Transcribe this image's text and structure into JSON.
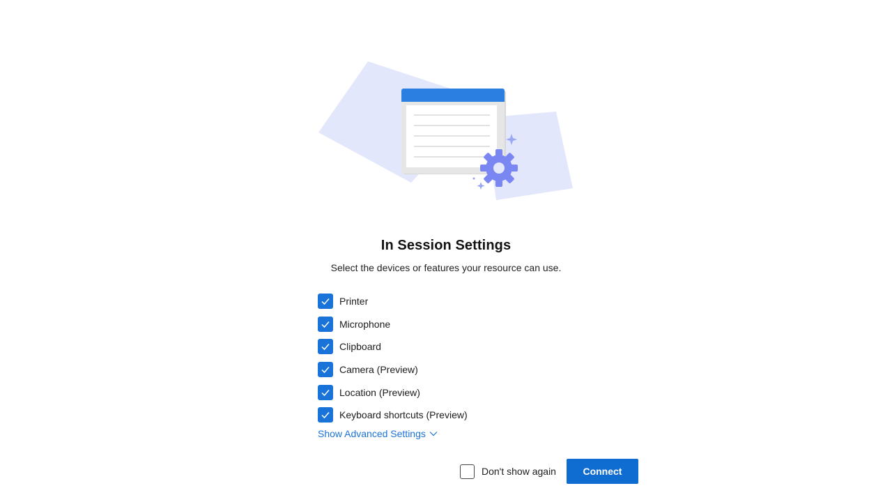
{
  "dialog": {
    "title": "In Session Settings",
    "subtitle": "Select the devices or features your resource can use.",
    "options": [
      {
        "label": "Printer",
        "checked": true
      },
      {
        "label": "Microphone",
        "checked": true
      },
      {
        "label": "Clipboard",
        "checked": true
      },
      {
        "label": "Camera (Preview)",
        "checked": true
      },
      {
        "label": "Location (Preview)",
        "checked": true
      },
      {
        "label": "Keyboard shortcuts (Preview)",
        "checked": true
      }
    ],
    "advanced_link": "Show Advanced Settings",
    "dont_show_again": {
      "label": "Don't show again",
      "checked": false
    },
    "connect_label": "Connect"
  },
  "colors": {
    "accent": "#1a73d9",
    "button": "#0f6cd0",
    "illustration_bg": "#e6e9fb",
    "gear": "#7a86f2"
  },
  "icons": {
    "illustration": "settings-window-illustration",
    "checkbox": "checkmark-icon",
    "chevron": "chevron-down-icon"
  }
}
